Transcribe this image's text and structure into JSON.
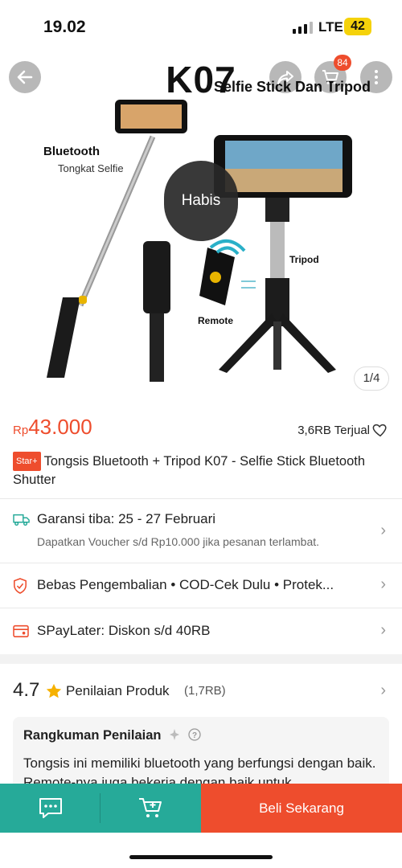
{
  "status_bar": {
    "time": "19.02",
    "network": "LTE",
    "battery": "42"
  },
  "image": {
    "overlay_title": "K07",
    "caption": "Selfie Stick Dan Tripod",
    "brand_text": "Bluetooth",
    "brand_sub": "Tongkat Selfie",
    "label_remote": "Remote",
    "label_tripod": "Tripod",
    "sold_out": "Habis",
    "page_indicator": "1/4",
    "cart_count": "84"
  },
  "product": {
    "currency": "Rp",
    "price": "43.000",
    "sold": "3,6RB Terjual",
    "badge": "Star+",
    "title": "Tongsis Bluetooth + Tripod K07 - Selfie Stick Bluetooth Shutter"
  },
  "shipping": {
    "line1": "Garansi tiba: 25 - 27 Februari",
    "line2": "Dapatkan Voucher s/d Rp10.000 jika pesanan terlambat."
  },
  "guarantees": "Bebas Pengembalian  •  COD-Cek Dulu  •  Protek...",
  "paylater": "SPayLater: Diskon s/d 40RB",
  "rating": {
    "score": "4.7",
    "label": "Penilaian Produk",
    "count": "(1,7RB)",
    "summary_title": "Rangkuman Penilaian",
    "summary_text": "Tongsis ini memiliki bluetooth yang berfungsi dengan baik. Remote-nya juga bekerja dengan baik untuk"
  },
  "bottom_bar": {
    "buy_label": "Beli Sekarang"
  },
  "colors": {
    "accent": "#ee4d2d",
    "teal": "#26aa99"
  }
}
